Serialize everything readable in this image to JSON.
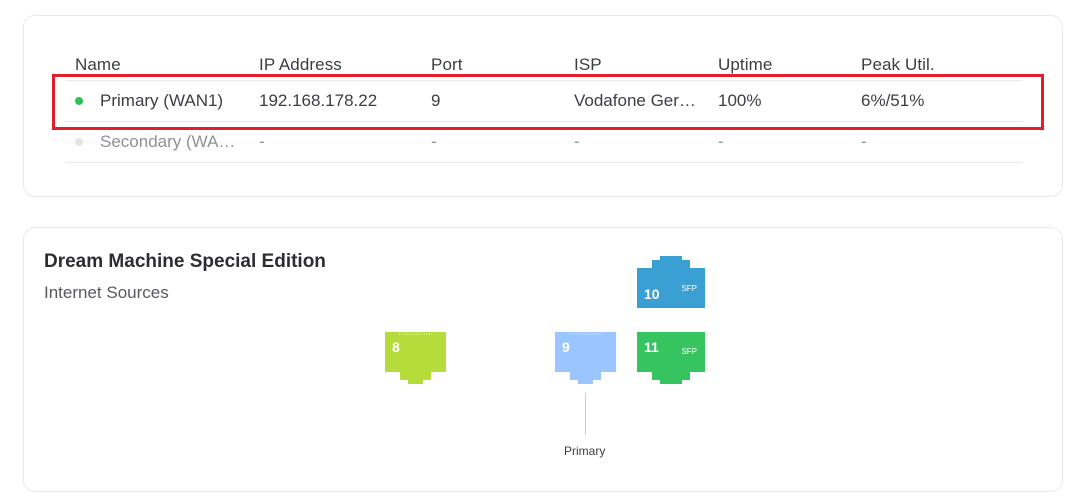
{
  "wan_table": {
    "columns": [
      "Name",
      "IP Address",
      "Port",
      "ISP",
      "Uptime",
      "Peak Util."
    ],
    "rows": [
      {
        "status_color": "#2fc25b",
        "name": "Primary (WAN1)",
        "ip": "192.168.178.22",
        "port": "9",
        "isp": "Vodafone Ger…",
        "uptime": "100%",
        "peak": "6%/51%"
      },
      {
        "status_color": "#e3e4e6",
        "name": "Secondary (WA…",
        "ip": "-",
        "port": "-",
        "isp": "-",
        "uptime": "-",
        "peak": "-"
      }
    ]
  },
  "device": {
    "title": "Dream Machine Special Edition",
    "subtitle": "Internet Sources",
    "ports": [
      {
        "number": "8",
        "color": "#b5dc3a",
        "icon": "lightning-icon"
      },
      {
        "number": "9",
        "color": "#9bc5ff",
        "icon": "globe-icon"
      },
      {
        "number": "10",
        "color": "#3a9fd2",
        "tag": "SFP"
      },
      {
        "number": "11",
        "color": "#35c45f",
        "tag": "SFP"
      }
    ],
    "primary_label": "Primary"
  },
  "colors": {
    "highlight": "#e01e2d"
  }
}
